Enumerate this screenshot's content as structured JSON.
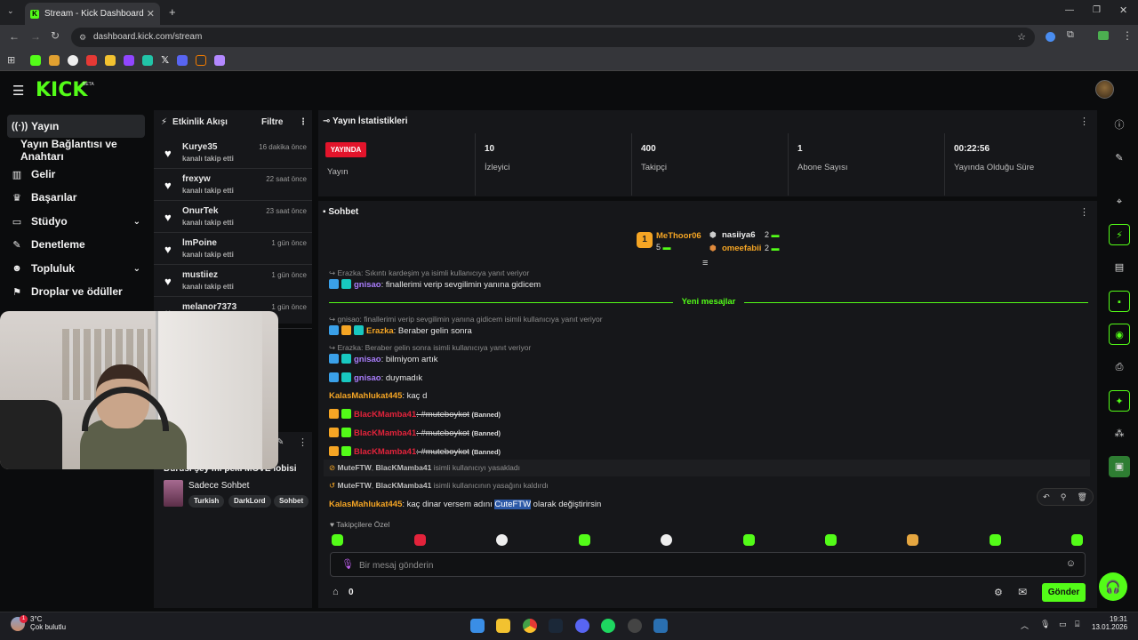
{
  "browser": {
    "tab_title": "Stream - Kick Dashboard",
    "url": "dashboard.kick.com/stream"
  },
  "header": {
    "logo": "KICK",
    "beta": "BETA"
  },
  "sidebar": {
    "items": [
      {
        "label": "Yayın",
        "icon": "broadcast-icon"
      },
      {
        "label": "Yayın Bağlantısı ve Anahtarı",
        "icon": ""
      },
      {
        "label": "Gelir",
        "icon": "chart-icon"
      },
      {
        "label": "Başarılar",
        "icon": "trophy-icon"
      },
      {
        "label": "Stüdyo",
        "icon": "studio-icon"
      },
      {
        "label": "Denetleme",
        "icon": "wrench-icon"
      },
      {
        "label": "Topluluk",
        "icon": "users-icon"
      },
      {
        "label": "Droplar ve ödüller",
        "icon": "gift-icon"
      }
    ]
  },
  "feed": {
    "title": "Etkinlik Akışı",
    "filter": "Filtre",
    "items": [
      {
        "name": "Kurye35",
        "sub": "kanalı takip etti",
        "time": "16 dakika önce"
      },
      {
        "name": "frexyw",
        "sub": "kanalı takip etti",
        "time": "22 saat önce"
      },
      {
        "name": "OnurTek",
        "sub": "kanalı takip etti",
        "time": "23 saat önce"
      },
      {
        "name": "lmPoine",
        "sub": "kanalı takip etti",
        "time": "1 gün önce"
      },
      {
        "name": "mustiiez",
        "sub": "kanalı takip etti",
        "time": "1 gün önce"
      },
      {
        "name": "melanor7373",
        "sub": "",
        "time": "1 gün önce"
      }
    ],
    "stream_title": "Durusi şey mi peki MOVE lobisi",
    "category": "Sadece Sohbet",
    "tags": [
      "Turkish",
      "DarkLord",
      "Sohbet"
    ]
  },
  "stats": {
    "title": "Yayın İstatistikleri",
    "live_badge": "YAYINDA",
    "cells": [
      {
        "value": "",
        "label": "Yayın"
      },
      {
        "value": "10",
        "label": "İzleyici"
      },
      {
        "value": "400",
        "label": "Takipçi"
      },
      {
        "value": "1",
        "label": "Abone Sayısı"
      },
      {
        "value": "00:22:56",
        "label": "Yayında Olduğu Süre"
      }
    ]
  },
  "chat": {
    "title": "Sohbet",
    "leaderboard": {
      "rank": "1",
      "first": {
        "name": "MeThoor06",
        "count": "5"
      },
      "second": {
        "name": "nasiiya6",
        "count": "2"
      },
      "third": {
        "name": "omeefabii",
        "count": "2"
      }
    },
    "new_messages": "Yeni mesajlar",
    "messages": [
      {
        "reply": "Erazka: Sıkıntı kardeşim ya isimli kullanıcıya yanıt veriyor"
      },
      {
        "user": "gnisao",
        "text": ": finallerimi verip sevgilimin yanına gidicem"
      },
      {
        "reply": "gnisao: finallerimi verip sevgilimin yanına gidicem isimli kullanıcıya yanıt veriyor"
      },
      {
        "user": "Erazka",
        "text": ": Beraber gelin sonra"
      },
      {
        "reply": "Erazka: Beraber gelin sonra isimli kullanıcıya yanıt veriyor"
      },
      {
        "user": "gnisao",
        "text": ": bilmiyom artık"
      },
      {
        "user": "gnisao",
        "text": ": duymadık"
      },
      {
        "user": "KalasMahlukat445",
        "text": ": kaç d"
      },
      {
        "user": "BlacKMamba41",
        "text": ": #muteboykot",
        "banned": "(Banned)"
      },
      {
        "user": "BlacKMamba41",
        "text": ": #muteboykot",
        "banned": "(Banned)"
      },
      {
        "user": "BlacKMamba41",
        "text": ": #muteboykot",
        "banned": "(Banned)"
      },
      {
        "sys_a": "MuteFTW",
        "sys_b": "BlacKMamba41",
        "sys_text": " isimli kullanıcıyı yasakladı"
      },
      {
        "sys_a": "MuteFTW",
        "sys_b": "BlacKMamba41",
        "sys_text": " isimli kullanıcının yasağını kaldırdı"
      },
      {
        "user": "KalasMahlukat445",
        "text_before": ": kaç dinar versem adını ",
        "highlight": "CuteFTW",
        "text_after": " olarak değiştirirsin"
      }
    ],
    "followers_only": "Takipçilere Özel",
    "input_placeholder": "Bir mesaj gönderin",
    "points": "0",
    "send": "Gönder"
  },
  "taskbar": {
    "temp": "3°C",
    "weather": "Çok bulutlu",
    "time": "19:31",
    "date": "13.01.2026",
    "weather_badge": "1"
  },
  "colors": {
    "accent": "#53fc18",
    "live": "#e3142b",
    "panel": "#16171a"
  }
}
